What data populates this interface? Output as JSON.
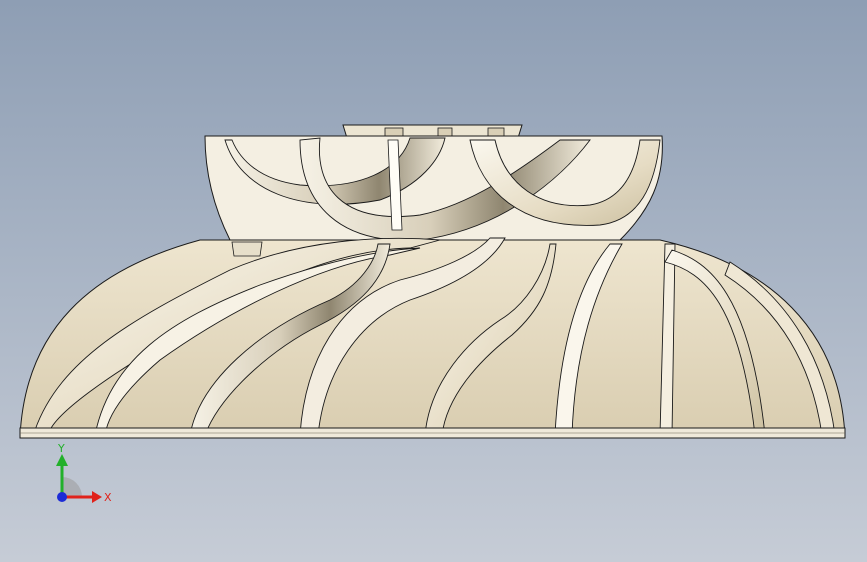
{
  "triad": {
    "x_label": "X",
    "y_label": "Y",
    "x_color": "#e0221b",
    "y_color": "#22b02a",
    "z_color": "#1c2bd6"
  },
  "model": {
    "face_color": "#efe9da",
    "shade_color": "#8f8670",
    "edge_color": "#1a1a1a"
  }
}
